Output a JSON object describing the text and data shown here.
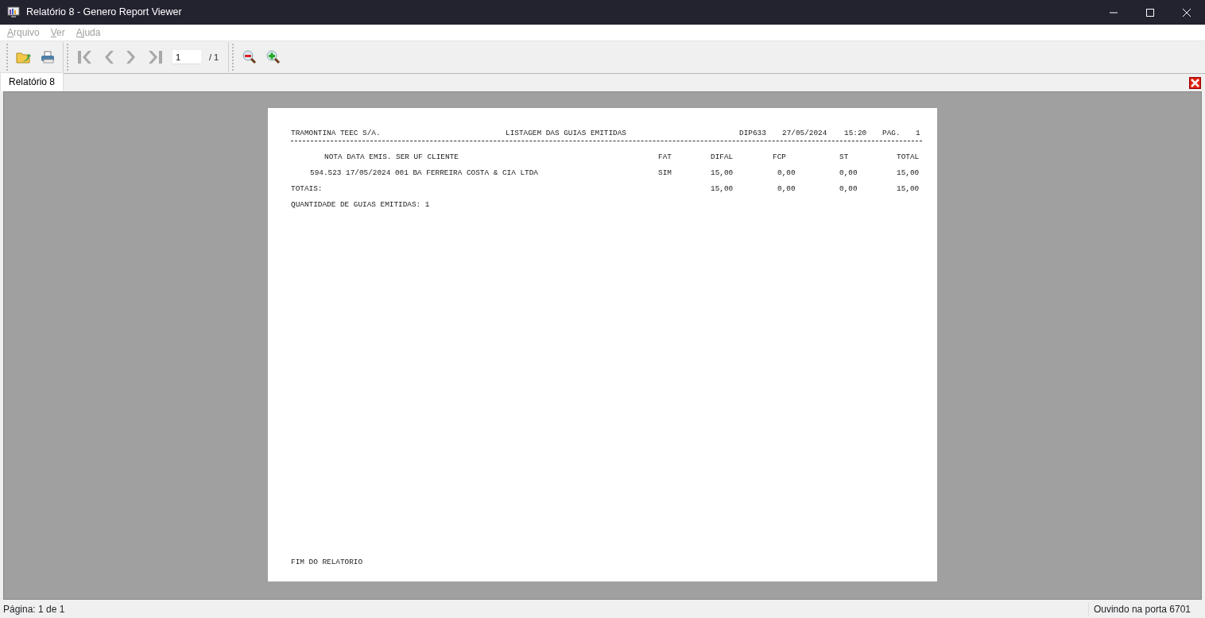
{
  "window": {
    "title": "Relatório 8 - Genero Report Viewer"
  },
  "menu": [
    {
      "label": "Arquivo",
      "disabled": true
    },
    {
      "label": "Ver",
      "disabled": true
    },
    {
      "label": "Ajuda",
      "disabled": true
    }
  ],
  "toolbar": {
    "page_input": "1",
    "page_total": "/ 1"
  },
  "tabs": [
    {
      "label": "Relatório 8",
      "selected": true
    }
  ],
  "report": {
    "header": [
      "TRAMONTINA TEEC S/A.",
      "LISTAGEM DAS GUIAS EMITIDAS",
      "DIP633",
      "27/05/2024",
      "15:20",
      "PAG.",
      "1"
    ],
    "columns": [
      "NOTA DATA EMIS. SER UF CLIENTE",
      "FAT",
      "DIFAL",
      "FCP",
      "ST",
      "TOTAL"
    ],
    "rows": [
      [
        "594.523 17/05/2024 001 BA FERREIRA COSTA & CIA LTDA",
        "SIM",
        "15,00",
        "0,00",
        "0,00",
        "15,00"
      ]
    ],
    "totals": {
      "label": "TOTAIS:",
      "values": [
        "15,00",
        "0,00",
        "0,00",
        "15,00"
      ]
    },
    "count": "QUANTIDADE DE GUIAS EMITIDAS: 1",
    "footer": "FIM DO RELATORIO"
  },
  "status_bar": {
    "left": "Página: 1 de 1",
    "right": "Ouvindo na porta 6701"
  }
}
